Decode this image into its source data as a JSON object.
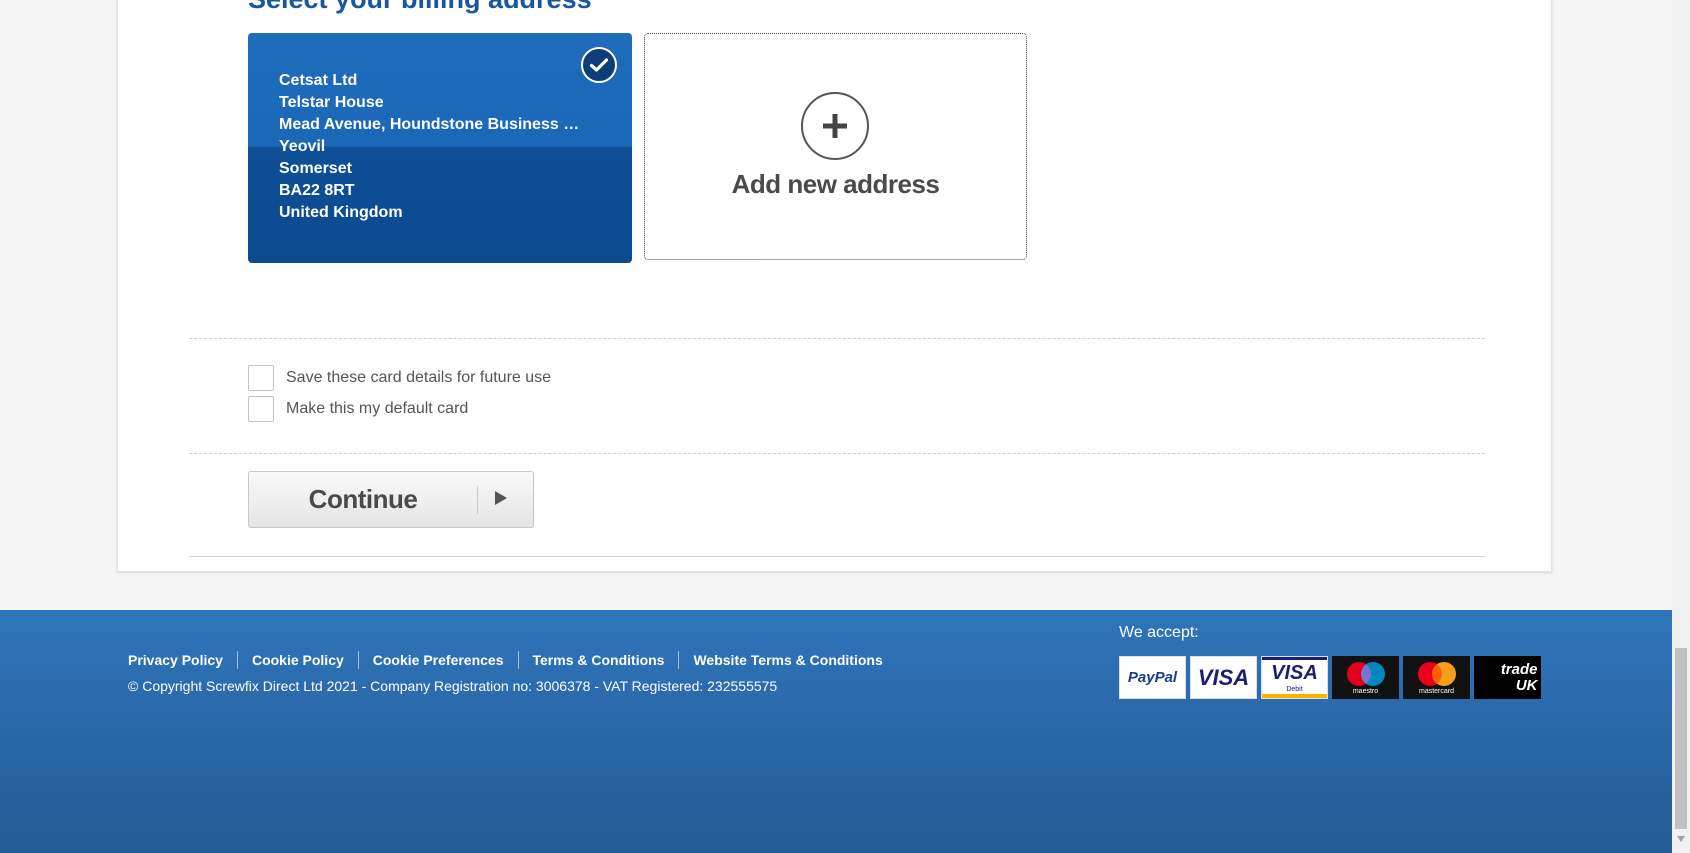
{
  "billing": {
    "heading": "Select your billing address",
    "selected_address": {
      "lines": [
        "Cetsat Ltd",
        "Telstar House",
        "Mead Avenue, Houndstone Business …",
        "Yeovil",
        "Somerset",
        "BA22 8RT",
        "United Kingdom"
      ]
    },
    "add_new_label": "Add new address"
  },
  "options": {
    "save_card_label": "Save these card details for future use",
    "default_card_label": "Make this my default card"
  },
  "continue_label": "Continue",
  "footer": {
    "links": [
      "Privacy Policy",
      "Cookie Policy",
      "Cookie Preferences",
      "Terms & Conditions",
      "Website Terms & Conditions"
    ],
    "copyright": "© Copyright Screwfix Direct Ltd 2021 - Company Registration no: 3006378 - VAT Registered: 232555575",
    "we_accept": "We accept:",
    "payment_cards": [
      {
        "name": "paypal-logo",
        "text": "PayPal"
      },
      {
        "name": "visa-logo",
        "text": "VISA"
      },
      {
        "name": "visa-debit-logo",
        "text": "VISA",
        "sub": "Debit"
      },
      {
        "name": "maestro-logo",
        "text": "maestro"
      },
      {
        "name": "mastercard-logo",
        "text": "mastercard"
      },
      {
        "name": "trade-uk-logo",
        "text": "trade UK"
      }
    ]
  },
  "colors": {
    "brand_blue": "#1a56a0",
    "card_blue": "#1b68b8",
    "footer_blue": "#2f75ba"
  }
}
